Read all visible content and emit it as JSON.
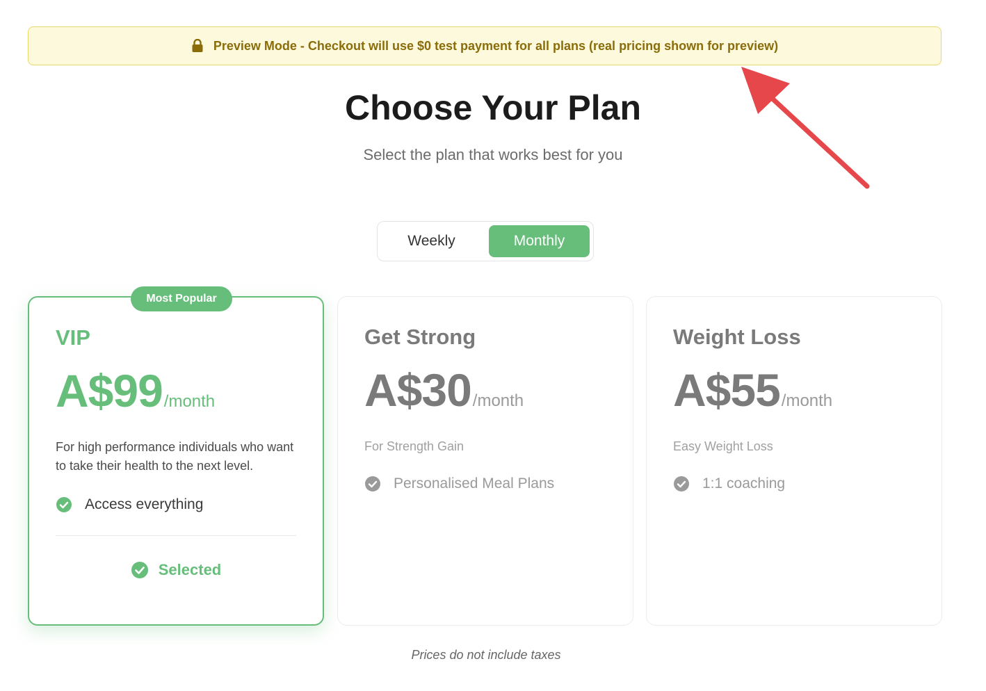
{
  "banner": {
    "icon": "lock-icon",
    "text": "Preview Mode - Checkout will use $0 test payment for all plans (real pricing shown for preview)"
  },
  "header": {
    "title": "Choose Your Plan",
    "subtitle": "Select the plan that works best for you"
  },
  "billing_toggle": {
    "options": [
      "Weekly",
      "Monthly"
    ],
    "selected": "Monthly"
  },
  "plans": [
    {
      "badge": "Most Popular",
      "name": "VIP",
      "price": "A$99",
      "period": "/month",
      "description": "For high performance individuals who want to take their health to the next level.",
      "features": [
        "Access everything"
      ],
      "status": "Selected"
    },
    {
      "name": "Get Strong",
      "price": "A$30",
      "period": "/month",
      "description": "For Strength Gain",
      "features": [
        "Personalised Meal Plans"
      ]
    },
    {
      "name": "Weight Loss",
      "price": "A$55",
      "period": "/month",
      "description": "Easy Weight Loss",
      "features": [
        "1:1 coaching"
      ]
    }
  ],
  "footnote": "Prices do not include taxes",
  "colors": {
    "accent": "#67be7b",
    "banner_bg": "#fdf9dc",
    "banner_text": "#8a6d0a",
    "annotation_arrow": "#e5474b"
  }
}
